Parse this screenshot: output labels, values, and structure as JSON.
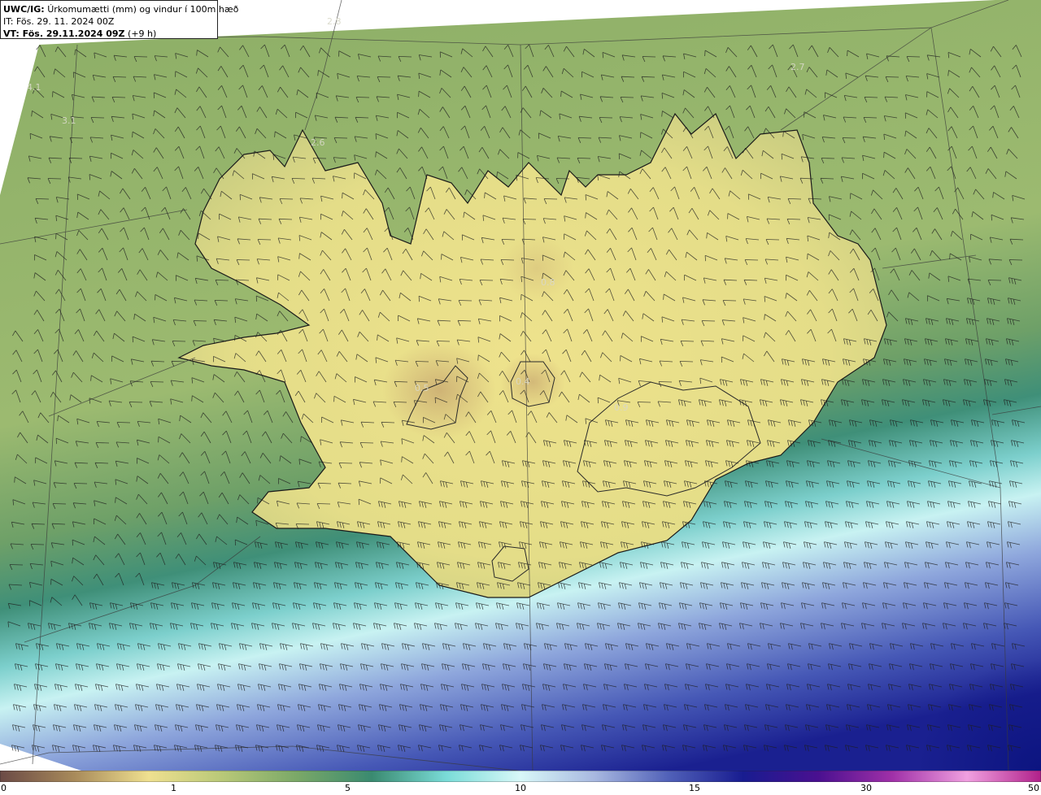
{
  "header": {
    "line1_bold": "UWC/IG:",
    "line1_rest": "Úrkomumætti (mm) og vindur í 100m hæð",
    "line2": "IT: Fös. 29. 11. 2024 00Z",
    "line3_bold": "VT: Fös. 29.11.2024 09Z",
    "line3_rest": "(+9 h)"
  },
  "field_labels": [
    {
      "text": "2.8"
    },
    {
      "text": "2.7"
    },
    {
      "text": "4.1"
    },
    {
      "text": "3.1"
    },
    {
      "text": "2.6"
    },
    {
      "text": "0.8"
    },
    {
      "text": "0.5"
    },
    {
      "text": "0.4"
    },
    {
      "text": "0.9"
    }
  ],
  "colorbar": {
    "ticks": [
      "0",
      "1",
      "5",
      "10",
      "15",
      "30",
      "50"
    ],
    "colors": [
      "#6b4a46",
      "#a88a5a",
      "#efe090",
      "#b8c878",
      "#7aa868",
      "#3a8a70",
      "#7adcd8",
      "#d8f8f8",
      "#a8b8e0",
      "#5060b8",
      "#181c90",
      "#4a1090",
      "#a030a8",
      "#f0a0e0",
      "#b0208a"
    ]
  },
  "colors": {
    "land_low": "#ece58c",
    "sea_green": "#8fb068",
    "teal": "#3f8f78",
    "cyan": "#bdeef0",
    "blue": "#5e72c4",
    "navy": "#121a88",
    "coast": "#1a1a1a"
  }
}
